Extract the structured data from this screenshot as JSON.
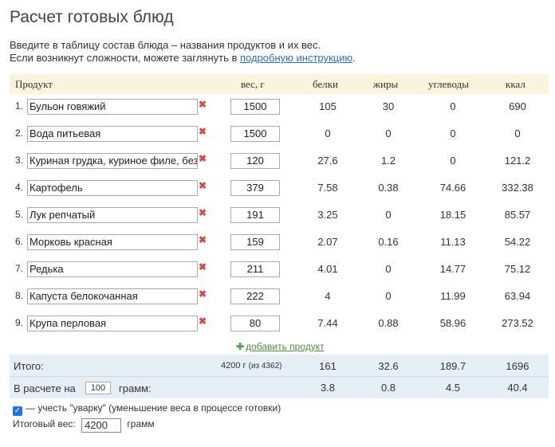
{
  "title": "Расчет готовых блюд",
  "intro": {
    "line1": "Введите в таблицу состав блюда – названия продуктов и их вес.",
    "line2_prefix": "Если возникнут сложности, можете заглянуть в ",
    "link": "подробную инструкцию",
    "line2_suffix": "."
  },
  "headers": {
    "product": "Продукт",
    "weight": "вес, г",
    "protein": "белки",
    "fat": "жиры",
    "carbs": "углеводы",
    "kcal": "ккал"
  },
  "rows": [
    {
      "n": "1.",
      "name": "Бульон говяжий",
      "weight": "1500",
      "p": "105",
      "f": "30",
      "c": "0",
      "k": "690"
    },
    {
      "n": "2.",
      "name": "Вода питьевая",
      "weight": "1500",
      "p": "0",
      "f": "0",
      "c": "0",
      "k": "0"
    },
    {
      "n": "3.",
      "name": "Куриная грудка, куриное филе, без",
      "weight": "120",
      "p": "27.6",
      "f": "1.2",
      "c": "0",
      "k": "121.2"
    },
    {
      "n": "4.",
      "name": "Картофель",
      "weight": "379",
      "p": "7.58",
      "f": "0.38",
      "c": "74.66",
      "k": "332.38"
    },
    {
      "n": "5.",
      "name": "Лук репчатый",
      "weight": "191",
      "p": "3.25",
      "f": "0",
      "c": "18.15",
      "k": "85.57"
    },
    {
      "n": "6.",
      "name": "Морковь красная",
      "weight": "159",
      "p": "2.07",
      "f": "0.16",
      "c": "11.13",
      "k": "54.22"
    },
    {
      "n": "7.",
      "name": "Редька",
      "weight": "211",
      "p": "4.01",
      "f": "0",
      "c": "14.77",
      "k": "75.12"
    },
    {
      "n": "8.",
      "name": "Капуста белокочанная",
      "weight": "222",
      "p": "4",
      "f": "0",
      "c": "11.99",
      "k": "63.94"
    },
    {
      "n": "9.",
      "name": "Крупа перловая",
      "weight": "80",
      "p": "7.44",
      "f": "0.88",
      "c": "58.96",
      "k": "273.52"
    }
  ],
  "delete_glyph": "✖",
  "add_label": "добавить продукт",
  "total": {
    "label": "Итого:",
    "weight": "4200 г",
    "weight_of": "(из 4362)",
    "p": "161",
    "f": "32.6",
    "c": "189.7",
    "k": "1696"
  },
  "per": {
    "label": "В расчете на",
    "value": "100",
    "unit": "грамм:",
    "p": "3.8",
    "f": "0.8",
    "c": "4.5",
    "k": "40.4"
  },
  "boil": {
    "label": "— учесть \"уварку\" (уменьшение веса в процессе готовки)",
    "checked": true
  },
  "final_weight": {
    "label": "Итоговый вес:",
    "value": "4200",
    "unit": "грамм"
  }
}
